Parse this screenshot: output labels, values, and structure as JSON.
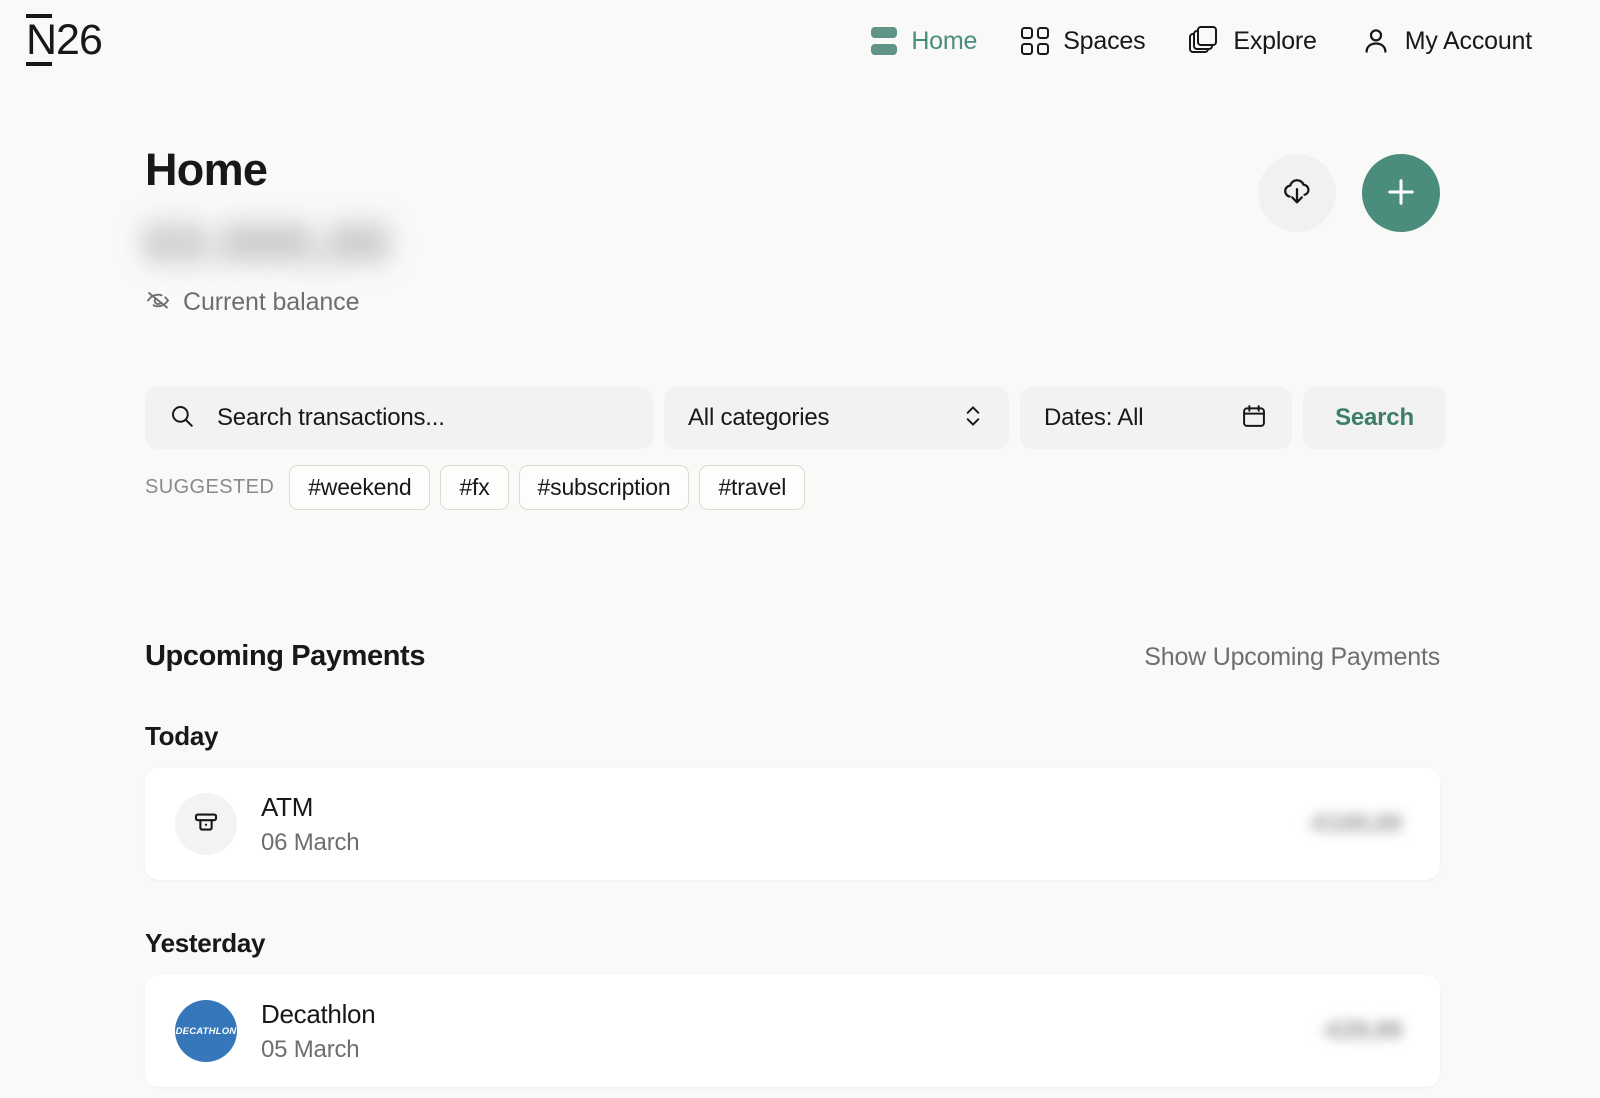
{
  "brand": {
    "logo_text": "N26",
    "accent_green": "#4b8d7c",
    "link_green": "#3e7d6c",
    "page_background": "#f9f9f8",
    "card_background": "#ffffff"
  },
  "nav": {
    "items": [
      {
        "label": "Home",
        "icon": "home-icon",
        "active": true
      },
      {
        "label": "Spaces",
        "icon": "spaces-grid-icon",
        "active": false
      },
      {
        "label": "Explore",
        "icon": "explore-layers-icon",
        "active": false
      },
      {
        "label": "My Account",
        "icon": "person-icon",
        "active": false
      }
    ]
  },
  "header": {
    "title": "Home",
    "download_button": "cloud-download-icon",
    "add_button": "plus-icon",
    "balance_masked": "€0.000,00",
    "balance_label": "Current balance",
    "balance_visibility_icon": "eye-off-icon"
  },
  "search": {
    "placeholder": "Search transactions...",
    "value": "",
    "search_icon": "search-icon",
    "category_selected": "All categories",
    "category_icon": "chevron-updown-icon",
    "dates_selected": "Dates: All",
    "dates_icon": "calendar-icon",
    "search_button": "Search"
  },
  "suggested": {
    "label": "SUGGESTED",
    "tags": [
      "#weekend",
      "#fx",
      "#subscription",
      "#travel"
    ]
  },
  "upcoming": {
    "title": "Upcoming Payments",
    "link": "Show Upcoming Payments",
    "groups": [
      {
        "day": "Today",
        "transactions": [
          {
            "name": "ATM",
            "date": "06 March",
            "amount_masked": "-€100,00",
            "avatar_type": "icon",
            "avatar_icon": "atm-icon",
            "avatar_label": ""
          }
        ]
      },
      {
        "day": "Yesterday",
        "transactions": [
          {
            "name": "Decathlon",
            "date": "05 March",
            "amount_masked": "-€29,99",
            "avatar_type": "brand",
            "avatar_icon": "",
            "avatar_label": "DECATHLON",
            "avatar_color": "#3577b8"
          }
        ]
      }
    ]
  }
}
